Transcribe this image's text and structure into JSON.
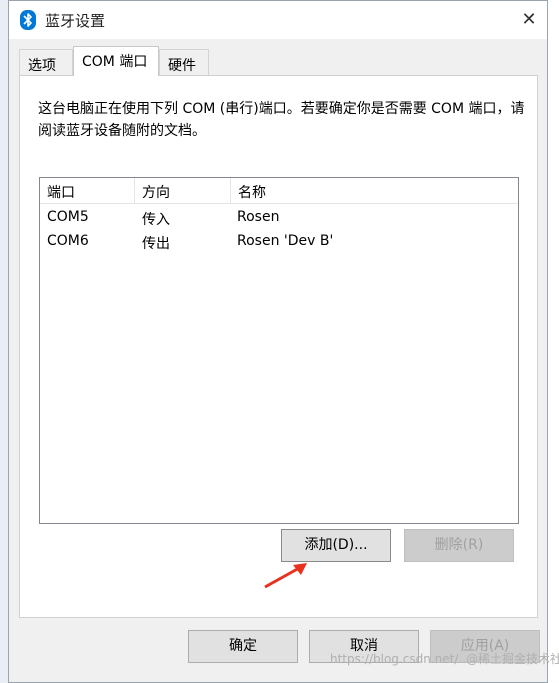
{
  "window": {
    "title": "蓝牙设置"
  },
  "tabs": [
    {
      "label": "选项"
    },
    {
      "label": "COM 端口"
    },
    {
      "label": "硬件"
    }
  ],
  "description": "这台电脑正在使用下列 COM (串行)端口。若要确定你是否需要 COM 端口，请阅读蓝牙设备随附的文档。",
  "table": {
    "columns": [
      "端口",
      "方向",
      "名称"
    ],
    "rows": [
      {
        "port": "COM5",
        "direction": "传入",
        "name": "Rosen"
      },
      {
        "port": "COM6",
        "direction": "传出",
        "name": "Rosen 'Dev B'"
      }
    ]
  },
  "buttons": {
    "add": "添加(D)...",
    "remove": "删除(R)",
    "ok": "确定",
    "cancel": "取消",
    "apply": "应用(A)"
  },
  "watermark": "https://blog.csdn.net/..@稀土掘金技术社区",
  "colors": {
    "bluetooth": "#0078d7",
    "arrow": "#e8321e"
  }
}
